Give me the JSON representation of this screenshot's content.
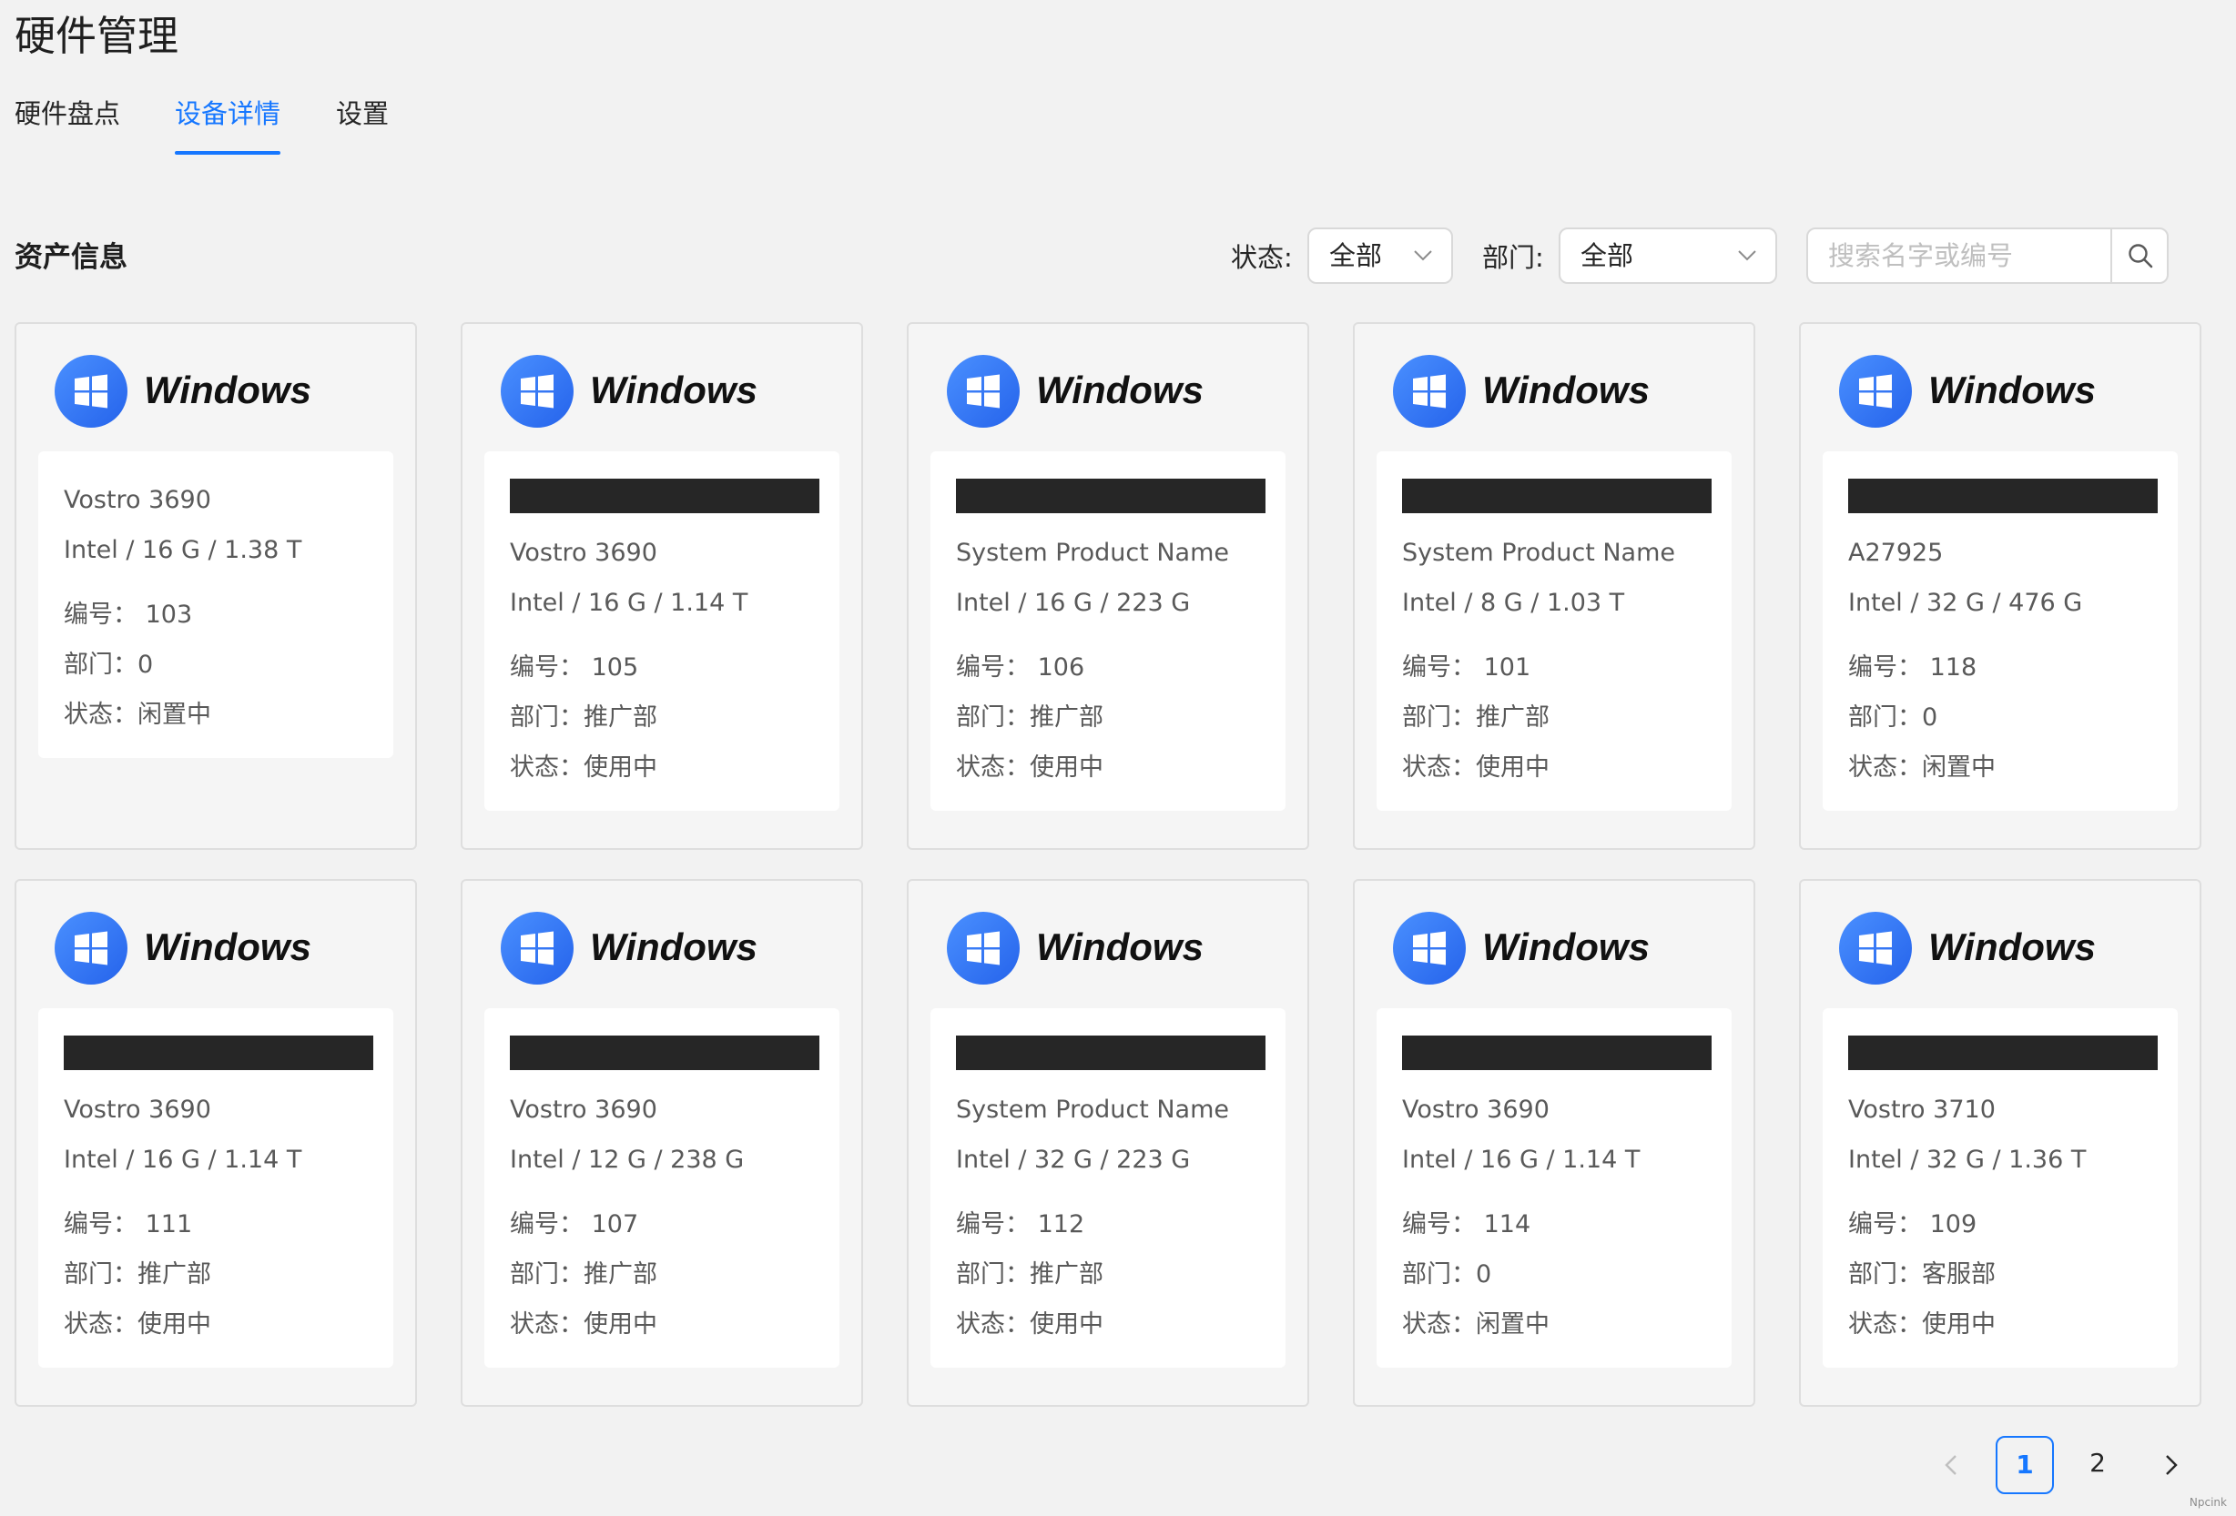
{
  "page": {
    "title": "硬件管理"
  },
  "tabs": [
    {
      "label": "硬件盘点",
      "active": false
    },
    {
      "label": "设备详情",
      "active": true
    },
    {
      "label": "设置",
      "active": false
    }
  ],
  "section": {
    "title": "资产信息"
  },
  "filters": {
    "status_label": "状态:",
    "status_value": "全部",
    "department_label": "部门:",
    "department_value": "全部",
    "search_placeholder": "搜索名字或编号"
  },
  "card_labels": {
    "number": "编号：",
    "department": "部门：",
    "status": "状态："
  },
  "devices": [
    {
      "os": "Windows",
      "redacted": false,
      "model": "Vostro 3690",
      "specs": "Intel / 16 G / 1.38 T",
      "number": "103",
      "department": "0",
      "status": "闲置中"
    },
    {
      "os": "Windows",
      "redacted": true,
      "model": "Vostro 3690",
      "specs": "Intel / 16 G / 1.14 T",
      "number": "105",
      "department": "推广部",
      "status": "使用中"
    },
    {
      "os": "Windows",
      "redacted": true,
      "model": "System Product Name",
      "specs": "Intel / 16 G / 223 G",
      "number": "106",
      "department": "推广部",
      "status": "使用中"
    },
    {
      "os": "Windows",
      "redacted": true,
      "model": "System Product Name",
      "specs": "Intel / 8 G / 1.03 T",
      "number": "101",
      "department": "推广部",
      "status": "使用中"
    },
    {
      "os": "Windows",
      "redacted": true,
      "model": "A27925",
      "specs": "Intel / 32 G / 476 G",
      "number": "118",
      "department": "0",
      "status": "闲置中"
    },
    {
      "os": "Windows",
      "redacted": true,
      "model": "Vostro 3690",
      "specs": "Intel / 16 G / 1.14 T",
      "number": "111",
      "department": "推广部",
      "status": "使用中"
    },
    {
      "os": "Windows",
      "redacted": true,
      "model": "Vostro 3690",
      "specs": "Intel / 12 G / 238 G",
      "number": "107",
      "department": "推广部",
      "status": "使用中"
    },
    {
      "os": "Windows",
      "redacted": true,
      "model": "System Product Name",
      "specs": "Intel / 32 G / 223 G",
      "number": "112",
      "department": "推广部",
      "status": "使用中"
    },
    {
      "os": "Windows",
      "redacted": true,
      "model": "Vostro 3690",
      "specs": "Intel / 16 G / 1.14 T",
      "number": "114",
      "department": "0",
      "status": "闲置中"
    },
    {
      "os": "Windows",
      "redacted": true,
      "model": "Vostro 3710",
      "specs": "Intel / 32 G / 1.36 T",
      "number": "109",
      "department": "客服部",
      "status": "使用中"
    }
  ],
  "pagination": {
    "pages": [
      "1",
      "2"
    ],
    "current": "1"
  },
  "watermark": "Npcink",
  "colors": {
    "accent": "#1677ff",
    "windows_logo": "#2f6bf2",
    "background": "#f2f2f2",
    "redaction": "#262626"
  },
  "icons": {
    "status_dropdown": "chevron-down-icon",
    "department_dropdown": "chevron-down-icon",
    "search": "search-icon",
    "os_logo": "windows-logo-icon",
    "prev": "chevron-left-icon",
    "next": "chevron-right-icon"
  }
}
